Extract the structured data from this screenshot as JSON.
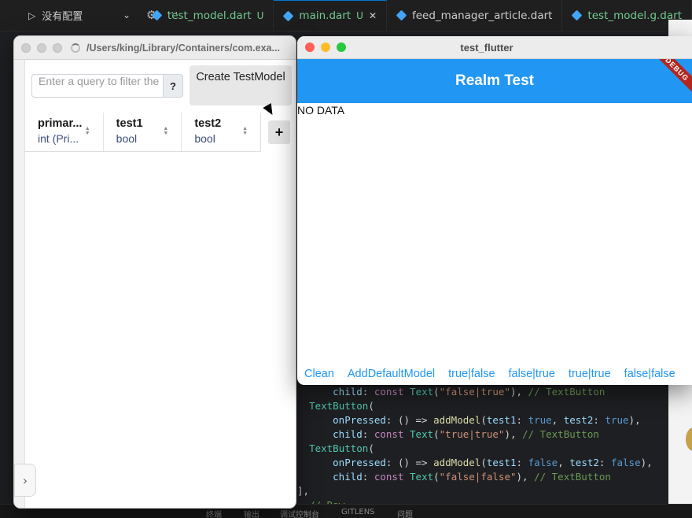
{
  "vscode": {
    "run_config": "没有配置",
    "tabs": [
      {
        "name": "test_model.dart",
        "status": "U",
        "active": false,
        "green": true
      },
      {
        "name": "main.dart",
        "status": "U",
        "active": true,
        "green": true
      },
      {
        "name": "feed_manager_article.dart",
        "status": "",
        "active": false,
        "green": false
      },
      {
        "name": "test_model.g.dart",
        "status": "",
        "active": false,
        "green": true
      }
    ],
    "code": [
      {
        "indent": "      ",
        "parts": [
          [
            "param",
            "child"
          ],
          [
            "plain",
            ": "
          ],
          [
            "kw",
            "const "
          ],
          [
            "cls",
            "Text"
          ],
          [
            "plain",
            "("
          ],
          [
            "str",
            "\"false|true\""
          ],
          [
            "plain",
            "), "
          ],
          [
            "cmt",
            "// TextButton"
          ]
        ]
      },
      {
        "indent": "  ",
        "parts": [
          [
            "cls",
            "TextButton"
          ],
          [
            "plain",
            "("
          ]
        ]
      },
      {
        "indent": "      ",
        "parts": [
          [
            "param",
            "onPressed"
          ],
          [
            "plain",
            ": () => "
          ],
          [
            "fn",
            "addModel"
          ],
          [
            "plain",
            "("
          ],
          [
            "param",
            "test1"
          ],
          [
            "plain",
            ": "
          ],
          [
            "bool",
            "true"
          ],
          [
            "plain",
            ", "
          ],
          [
            "param",
            "test2"
          ],
          [
            "plain",
            ": "
          ],
          [
            "bool",
            "true"
          ],
          [
            "plain",
            "),"
          ]
        ]
      },
      {
        "indent": "      ",
        "parts": [
          [
            "param",
            "child"
          ],
          [
            "plain",
            ": "
          ],
          [
            "kw",
            "const "
          ],
          [
            "cls",
            "Text"
          ],
          [
            "plain",
            "("
          ],
          [
            "str",
            "\"true|true\""
          ],
          [
            "plain",
            "), "
          ],
          [
            "cmt",
            "// TextButton"
          ]
        ]
      },
      {
        "indent": "  ",
        "parts": [
          [
            "cls",
            "TextButton"
          ],
          [
            "plain",
            "("
          ]
        ]
      },
      {
        "indent": "      ",
        "parts": [
          [
            "param",
            "onPressed"
          ],
          [
            "plain",
            ": () => "
          ],
          [
            "fn",
            "addModel"
          ],
          [
            "plain",
            "("
          ],
          [
            "param",
            "test1"
          ],
          [
            "plain",
            ": "
          ],
          [
            "bool",
            "false"
          ],
          [
            "plain",
            ", "
          ],
          [
            "param",
            "test2"
          ],
          [
            "plain",
            ": "
          ],
          [
            "bool",
            "false"
          ],
          [
            "plain",
            "),"
          ]
        ]
      },
      {
        "indent": "      ",
        "parts": [
          [
            "param",
            "child"
          ],
          [
            "plain",
            ": "
          ],
          [
            "kw",
            "const "
          ],
          [
            "cls",
            "Text"
          ],
          [
            "plain",
            "("
          ],
          [
            "str",
            "\"false|false\""
          ],
          [
            "plain",
            "), "
          ],
          [
            "cmt",
            "// TextButton"
          ]
        ]
      },
      {
        "indent": "",
        "parts": [
          [
            "plain",
            "],"
          ]
        ]
      },
      {
        "indent": "  ",
        "parts": [
          [
            "cmt",
            "// Row"
          ]
        ]
      }
    ],
    "bottom_tabs": [
      "终端",
      "输出",
      "调试控制台",
      "GITLENS",
      "问题"
    ]
  },
  "realm": {
    "path": "/Users/king/Library/Containers/com.exa...",
    "query_placeholder": "Enter a query to filter the list",
    "help": "?",
    "create_button": "Create TestModel",
    "columns": [
      {
        "name": "primar...",
        "type": "int (Pri..."
      },
      {
        "name": "test1",
        "type": "bool"
      },
      {
        "name": "test2",
        "type": "bool"
      }
    ],
    "add_column": "+",
    "collapse": "›"
  },
  "flutter": {
    "window_title": "test_flutter",
    "appbar_title": "Realm Test",
    "debug_banner": "DEBUG",
    "empty_text": "NO DATA",
    "buttons": [
      "Clean",
      "AddDefaultModel",
      "true|false",
      "false|true",
      "true|true",
      "false|false"
    ]
  },
  "colors": {
    "flutter_primary": "#2196f3",
    "vscode_bg": "#1e1f22"
  }
}
